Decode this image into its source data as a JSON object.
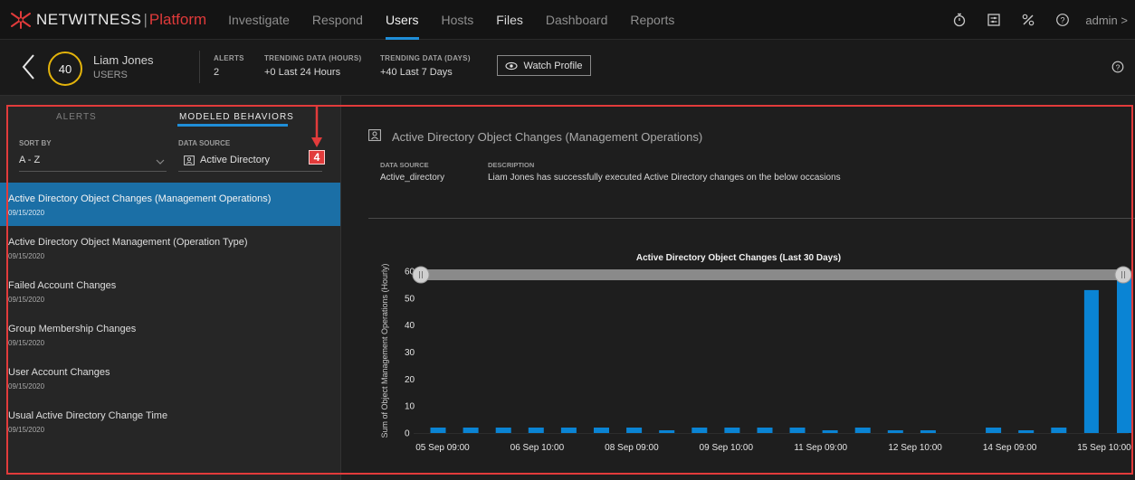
{
  "topnav": {
    "brand_name": "NETWITNESS",
    "brand_sep": "|",
    "brand_product": "Platform",
    "links": [
      {
        "label": "Investigate"
      },
      {
        "label": "Respond"
      },
      {
        "label": "Users"
      },
      {
        "label": "Hosts"
      },
      {
        "label": "Files"
      },
      {
        "label": "Dashboard"
      },
      {
        "label": "Reports"
      }
    ],
    "icons": [
      "timer-icon",
      "settings-panel-icon",
      "tools-icon",
      "help-icon"
    ],
    "user_label": "admin >"
  },
  "header": {
    "score": "40",
    "entity_name": "Liam Jones",
    "entity_type": "USERS",
    "alerts_label": "ALERTS",
    "alerts_value": "2",
    "trend_hours_label": "TRENDING DATA (HOURS)",
    "trend_hours_value": "+0  Last 24 Hours",
    "trend_days_label": "TRENDING DATA (DAYS)",
    "trend_days_value": "+40  Last 7 Days",
    "watch_label": "Watch Profile"
  },
  "left": {
    "tab_alerts": "ALERTS",
    "tab_behaviors": "MODELED BEHAVIORS",
    "sort_label": "SORT BY",
    "sort_value": "A - Z",
    "source_label": "DATA SOURCE",
    "source_value": "Active Directory",
    "items": [
      {
        "title": "Active Directory Object Changes (Management Operations)",
        "date": "09/15/2020"
      },
      {
        "title": "Active Directory Object Management (Operation Type)",
        "date": "09/15/2020"
      },
      {
        "title": "Failed Account Changes",
        "date": "09/15/2020"
      },
      {
        "title": "Group Membership Changes",
        "date": "09/15/2020"
      },
      {
        "title": "User Account Changes",
        "date": "09/15/2020"
      },
      {
        "title": "Usual Active Directory Change Time",
        "date": "09/15/2020"
      }
    ]
  },
  "detail": {
    "title": "Active Directory Object Changes (Management Operations)",
    "source_label": "DATA SOURCE",
    "source_value": "Active_directory",
    "desc_label": "DESCRIPTION",
    "desc_value": "Liam Jones has successfully executed Active Directory changes on the below occasions"
  },
  "annotation": {
    "number": "4"
  },
  "colors": {
    "accent": "#1f8ed8",
    "bar": "#0a84d4",
    "highlight": "#e23b3b",
    "score_ring": "#e4b40b"
  },
  "chart_data": {
    "type": "bar",
    "title": "Active Directory Object Changes (Last 30 Days)",
    "ylabel": "Sum of Object Management Operations (Hourly)",
    "xlabel": "",
    "ylim": [
      0,
      60
    ],
    "yticks": [
      0,
      10,
      20,
      30,
      40,
      50,
      60
    ],
    "x_tick_labels": [
      "05 Sep 09:00",
      "06 Sep 10:00",
      "08 Sep 09:00",
      "09 Sep 10:00",
      "11 Sep 09:00",
      "12 Sep 10:00",
      "14 Sep 09:00",
      "15 Sep 10:00"
    ],
    "values": [
      2,
      2,
      2,
      2,
      2,
      2,
      2,
      1,
      2,
      2,
      2,
      2,
      1,
      2,
      1,
      1,
      0,
      2,
      1,
      2,
      53,
      58
    ],
    "grid": false,
    "legend": "none"
  }
}
